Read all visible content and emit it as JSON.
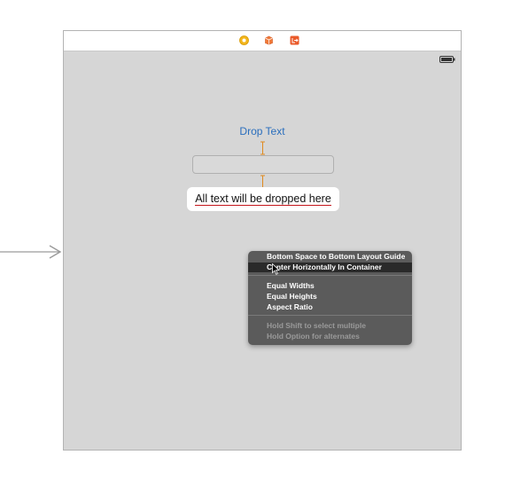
{
  "scene": {
    "dock_icons": [
      "view-controller-icon",
      "first-responder-icon",
      "exit-icon"
    ],
    "colors": {
      "canvas": "#d6d6d6",
      "accent": "#2a6ebd",
      "constraint": "#e08a1e",
      "menu_bg": "#5b5b5b"
    }
  },
  "view": {
    "title_text": "Drop Text",
    "textfield_value": "",
    "label_text": "All text will be dropped here"
  },
  "context_menu": {
    "items": [
      {
        "label": "Bottom Space to Bottom Layout Guide",
        "state": "normal"
      },
      {
        "label": "Center Horizontally In Container",
        "state": "selected"
      },
      {
        "label": "Equal Widths",
        "state": "normal"
      },
      {
        "label": "Equal Heights",
        "state": "normal"
      },
      {
        "label": "Aspect Ratio",
        "state": "normal"
      },
      {
        "label": "Hold Shift to select multiple",
        "state": "disabled"
      },
      {
        "label": "Hold Option for alternates",
        "state": "disabled"
      }
    ]
  }
}
